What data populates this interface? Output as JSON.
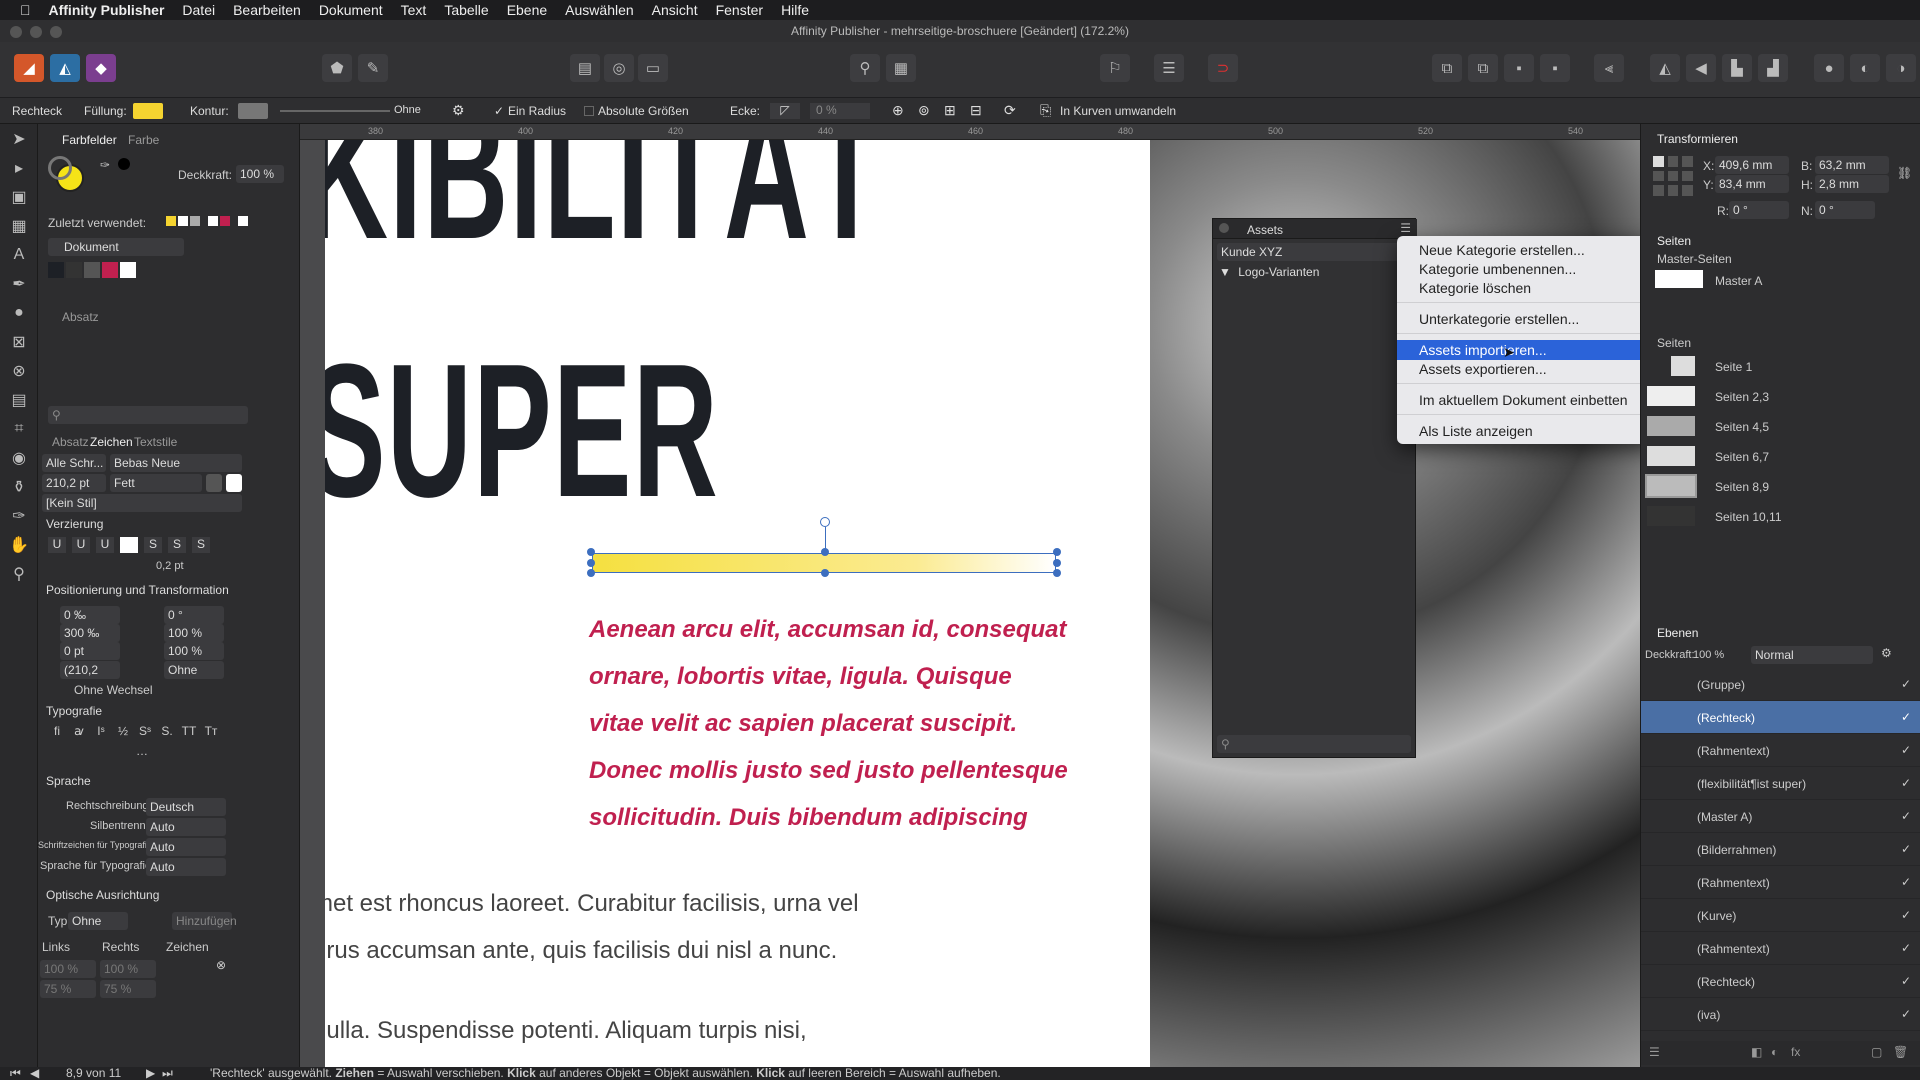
{
  "menubar": {
    "apple": "",
    "app": "Affinity Publisher",
    "items": [
      "Datei",
      "Bearbeiten",
      "Dokument",
      "Text",
      "Tabelle",
      "Ebene",
      "Auswählen",
      "Ansicht",
      "Fenster",
      "Hilfe"
    ]
  },
  "window": {
    "title": "Affinity Publisher - mehrseitige-broschuere [Geändert] (172.2%)"
  },
  "context": {
    "tool": "Rechteck",
    "fill_label": "Füllung:",
    "stroke_label": "Kontur:",
    "stroke_none": "Ohne",
    "one_radius": "Ein Radius",
    "absolute_sizes": "Absolute Größen",
    "corner_label": "Ecke:",
    "corner_value": "0 %",
    "convert_curves": "In Kurven umwandeln",
    "fill_color": "#f5d430",
    "stroke_color": "#777777"
  },
  "left": {
    "tabs": [
      "Farbfelder",
      "Farbe"
    ],
    "opacity_label": "Deckkraft:",
    "opacity_value": "100 %",
    "recent_label": "Zuletzt verwendet:",
    "palette": "Dokument",
    "char_tabs": [
      "Absatz",
      "Zeichen",
      "Textstile"
    ],
    "font_collection": "Alle Schr...",
    "font": "Bebas Neue",
    "size": "210,2 pt",
    "weight": "Fett",
    "style": "[Kein Stil]",
    "sec_deco": "Verzierung",
    "deco_buttons": [
      "U",
      "U",
      "U",
      "S",
      "S",
      "S"
    ],
    "deco_pt": "0,2 pt",
    "sec_pos": "Positionierung und Transformation",
    "pos": {
      "tracking": "0 ‰",
      "kerning": "300 ‰",
      "baseline": "0 pt",
      "lead": "(210,2",
      "italic": "0 °",
      "vscale": "100 %",
      "hscale": "100 %",
      "shear": "Ohne",
      "nobreak": "Ohne Wechsel"
    },
    "sec_typo": "Typografie",
    "typo_buttons": [
      "fi",
      "ꜹ",
      "Iˢ",
      "½",
      "Sˢ",
      "S.",
      "TT",
      "Tт",
      "…"
    ],
    "sec_lang": "Sprache",
    "lang": [
      {
        "label": "Rechtschreibung:",
        "value": "Deutsch"
      },
      {
        "label": "Silbentrennung:",
        "value": "Auto"
      },
      {
        "label": "Schriftzeichen für Typografie:",
        "value": "Auto"
      },
      {
        "label": "Sprache für Typografie:",
        "value": "Auto"
      }
    ],
    "sec_opt": "Optische Ausrichtung",
    "opt_type_label": "Typ:",
    "opt_type": "Ohne",
    "opt_add": "Hinzufügen",
    "opt_cols": [
      "Links",
      "Rechts",
      "Zeichen"
    ],
    "opt_row1": [
      "100 %",
      "100 %",
      ""
    ],
    "opt_row2": [
      "75 %",
      "75 %",
      ""
    ]
  },
  "ruler": {
    "ticks": [
      "380",
      "400",
      "420",
      "440",
      "460",
      "480",
      "500",
      "520",
      "540"
    ]
  },
  "page": {
    "headline1": "KIBILITÄT",
    "headline2": "SUPER",
    "pink_text": [
      "Aenean arcu elit, accumsan id, consequat",
      "ornare, lobortis vitae, ligula. Quisque",
      "vitae velit ac sapien placerat suscipit.",
      "Donec mollis justo sed justo pellentesque",
      "sollicitudin. Duis bibendum adipiscing"
    ],
    "body_text": [
      "met est rhoncus laoreet. Curabitur facilisis, urna vel",
      "urus accumsan ante, quis facilisis dui nisl a nunc.",
      "nulla. Suspendisse potenti. Aliquam turpis nisi,"
    ],
    "headline_color": "#1d2026",
    "pink_color": "#c0204f"
  },
  "assets": {
    "title": "Assets",
    "client": "Kunde XYZ",
    "category": "Logo-Varianten"
  },
  "contextmenu": {
    "items": [
      "Neue Kategorie erstellen...",
      "Kategorie umbenennen...",
      "Kategorie löschen",
      "Unterkategorie erstellen...",
      "Assets importieren...",
      "Assets exportieren...",
      "Im aktuellem Dokument einbetten",
      "Als Liste anzeigen"
    ],
    "highlight": "#2b63d9"
  },
  "transform": {
    "title": "Transformieren",
    "x": "409,6 mm",
    "y": "83,4 mm",
    "b": "63,2 mm",
    "h": "2,8 mm",
    "r": "0 °",
    "n": "0 °",
    "lx": "X:",
    "ly": "Y:",
    "lb": "B:",
    "lh": "H:",
    "lr": "R:",
    "ln": "N:"
  },
  "pages": {
    "tab": "Seiten",
    "master_header": "Master-Seiten",
    "master": "Master A",
    "pages_header": "Seiten",
    "list": [
      "Seite 1",
      "Seiten 2,3",
      "Seiten 4,5",
      "Seiten 6,7",
      "Seiten 8,9",
      "Seiten 10,11"
    ]
  },
  "layers": {
    "tab": "Ebenen",
    "opacity_label": "Deckkraft:",
    "opacity": "100 %",
    "blend": "Normal",
    "list": [
      "(Gruppe)",
      "(Rechteck)",
      "(Rahmentext)",
      "(flexibilität¶ist super)",
      "(Master A)",
      "(Bilderrahmen)",
      "(Rahmentext)",
      "(Kurve)",
      "(Rahmentext)",
      "(Rechteck)",
      "(iva)"
    ]
  },
  "status": {
    "page": "8,9 von 11",
    "msg1": "'Rechteck' ausgewählt. ",
    "b1": "Ziehen",
    "m2": " = Auswahl verschieben. ",
    "b2": "Klick",
    "m3": " auf anderes Objekt = Objekt auswählen. ",
    "b3": "Klick",
    "m4": " auf leeren Bereich = Auswahl aufheben."
  }
}
